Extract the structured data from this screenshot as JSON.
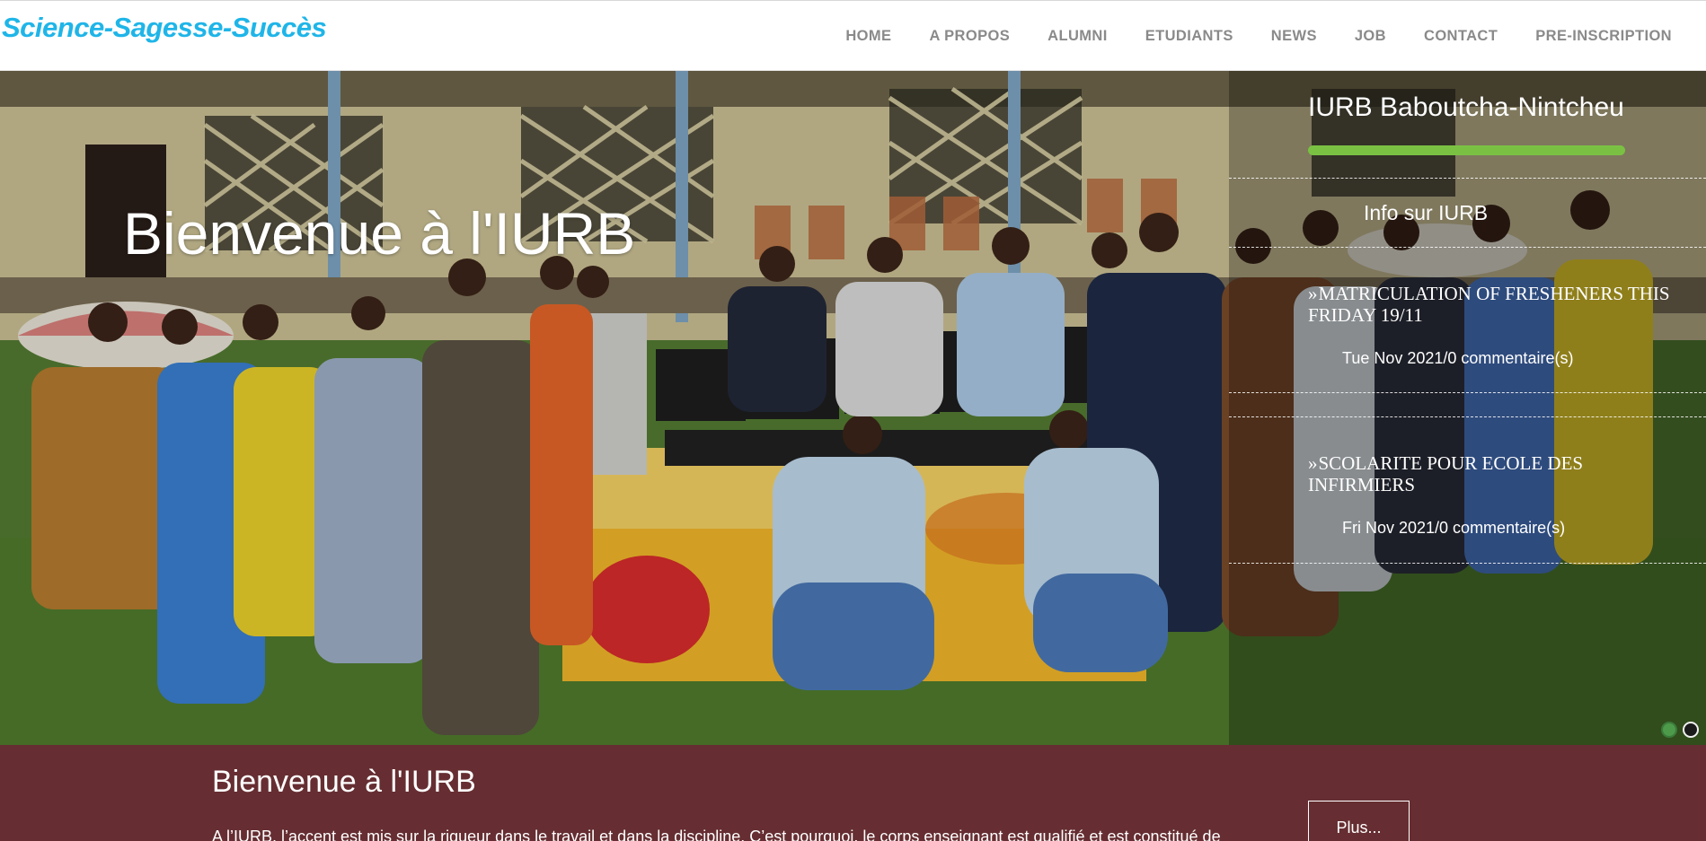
{
  "header": {
    "brand": "Science-Sagesse-Succès",
    "nav": [
      {
        "label": "HOME"
      },
      {
        "label": "A PROPOS"
      },
      {
        "label": "ALUMNI"
      },
      {
        "label": "ETUDIANTS"
      },
      {
        "label": "NEWS"
      },
      {
        "label": "JOB"
      },
      {
        "label": "CONTACT"
      },
      {
        "label": "PRE-INSCRIPTION"
      }
    ]
  },
  "hero": {
    "title": "Bienvenue à l'IURB",
    "panel": {
      "title": "IURB Baboutcha-Nintcheu",
      "subtitle": "Info sur IURB",
      "news": [
        {
          "chevron": "»",
          "title": "MATRICULATION OF FRESHENERS THIS FRIDAY 19/11",
          "meta": "Tue Nov 2021/0 commentaire(s)"
        },
        {
          "chevron": "»",
          "title": "SCOLARITE POUR ECOLE DES INFIRMIERS",
          "meta": "Fri Nov 2021/0 commentaire(s)"
        }
      ]
    }
  },
  "welcome": {
    "title": "Bienvenue à l'IURB",
    "text": "A l’IURB, l’accent est mis sur la rigueur dans le travail et dans la discipline. C’est pourquoi, le corps enseignant est qualifié et est constitué de",
    "button": "Plus..."
  },
  "colors": {
    "brand": "#1fb5e8",
    "nav": "#8a8a8a",
    "accent_bar": "#7ac143",
    "welcome_bg": "#662e32"
  }
}
